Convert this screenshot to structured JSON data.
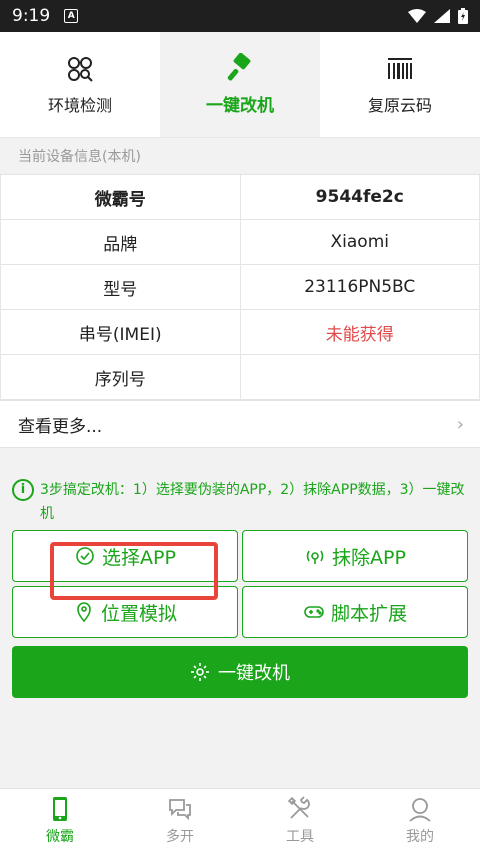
{
  "status": {
    "time": "9:19"
  },
  "tabs": [
    {
      "label": "环境检测"
    },
    {
      "label": "一键改机"
    },
    {
      "label": "复原云码"
    }
  ],
  "section_title": "当前设备信息(本机)",
  "device_info": [
    {
      "key": "微霸号",
      "value": "9544fe2c"
    },
    {
      "key": "品牌",
      "value": "Xiaomi"
    },
    {
      "key": "型号",
      "value": "23116PN5BC"
    },
    {
      "key": "串号(IMEI)",
      "value": "未能获得"
    },
    {
      "key": "序列号",
      "value": ""
    }
  ],
  "more_label": "查看更多...",
  "tip": "3步搞定改机：1）选择要伪装的APP，2）抹除APP数据，3）一键改机",
  "buttons": {
    "select_app": "选择APP",
    "erase_app": "抹除APP",
    "location": "位置模拟",
    "script": "脚本扩展",
    "one_click": "一键改机"
  },
  "nav": [
    {
      "label": "微霸"
    },
    {
      "label": "多开"
    },
    {
      "label": "工具"
    },
    {
      "label": "我的"
    }
  ],
  "colors": {
    "accent": "#1aa51a",
    "error": "#e04a4a",
    "highlight": "#e8443a"
  }
}
